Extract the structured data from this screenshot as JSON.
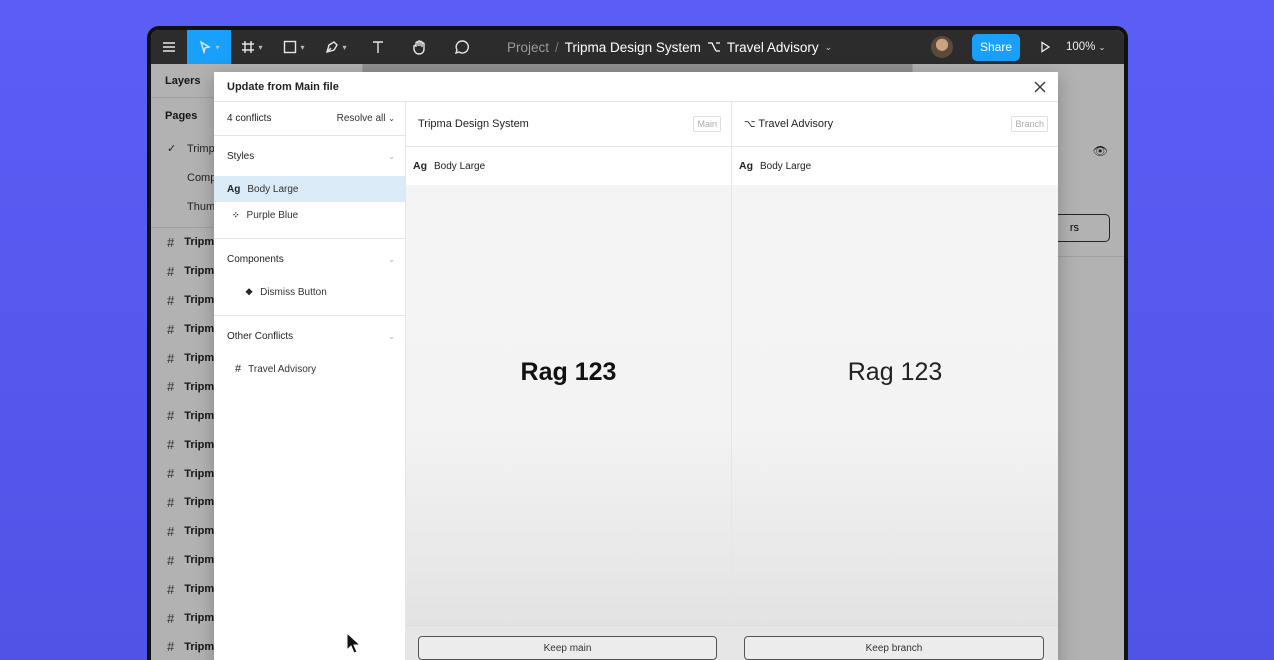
{
  "toolbar": {
    "project_label": "Project",
    "separator": "/",
    "file_name": "Tripma Design System",
    "branch_name": "Travel Advisory",
    "share_label": "Share",
    "zoom": "100%"
  },
  "layers_panel": {
    "tab_label": "Layers",
    "pages_label": "Pages",
    "pages": [
      "Trimpa",
      "Comp",
      "Thum"
    ],
    "frames": [
      "Tripm",
      "Tripm",
      "Tripm",
      "Tripm",
      "Tripm",
      "Tripm",
      "Tripm",
      "Tripm",
      "Tripm",
      "Tripm",
      "Tripm",
      "Tripm",
      "Tripm",
      "Tripm",
      "Tripm"
    ]
  },
  "modal": {
    "title": "Update from Main file",
    "conflicts_count": "4 conflicts",
    "resolve_all": "Resolve all",
    "sections": {
      "styles": {
        "label": "Styles",
        "items": [
          "Body Large",
          "Purple Blue"
        ]
      },
      "components": {
        "label": "Components",
        "items": [
          "Dismiss Button"
        ]
      },
      "other": {
        "label": "Other Conflicts",
        "items": [
          "Travel Advisory"
        ]
      }
    },
    "main_column": {
      "title": "Tripma Design System",
      "tag": "Main",
      "style_icon": "Ag",
      "style_name": "Body Large",
      "sample": "Rag 123",
      "button": "Keep main"
    },
    "branch_column": {
      "title": "Travel Advisory",
      "tag": "Branch",
      "style_icon": "Ag",
      "style_name": "Body Large",
      "sample": "Rag 123",
      "button": "Keep branch"
    }
  },
  "right_panel": {
    "button_partial": "rs"
  }
}
